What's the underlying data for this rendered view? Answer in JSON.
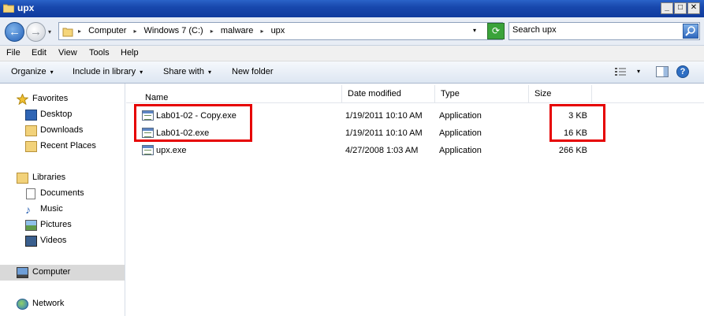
{
  "window": {
    "title": "upx",
    "minimize_glyph": "_",
    "maximize_glyph": "□",
    "close_glyph": "✕"
  },
  "address_bar": {
    "breadcrumbs": [
      "Computer",
      "Windows 7 (C:)",
      "malware",
      "upx"
    ],
    "separator": "▸",
    "dropdown_glyph": "▾"
  },
  "search": {
    "value": "Search upx"
  },
  "menu": {
    "items": [
      "File",
      "Edit",
      "View",
      "Tools",
      "Help"
    ]
  },
  "toolbar": {
    "organize": "Organize",
    "include_in_library": "Include in library",
    "share_with": "Share with",
    "new_folder": "New folder",
    "dropdown_glyph": "▾"
  },
  "nav_pane": {
    "favorites": {
      "label": "Favorites",
      "items": [
        "Desktop",
        "Downloads",
        "Recent Places"
      ]
    },
    "libraries": {
      "label": "Libraries",
      "items": [
        "Documents",
        "Music",
        "Pictures",
        "Videos"
      ]
    },
    "computer": "Computer",
    "network": "Network"
  },
  "file_list": {
    "columns": {
      "name": "Name",
      "date_modified": "Date modified",
      "type": "Type",
      "size": "Size"
    },
    "sort_glyph": "▴",
    "rows": [
      {
        "name": "Lab01-02 - Copy.exe",
        "date_modified": "1/19/2011 10:10 AM",
        "type": "Application",
        "size": "3 KB"
      },
      {
        "name": "Lab01-02.exe",
        "date_modified": "1/19/2011 10:10 AM",
        "type": "Application",
        "size": "16 KB"
      },
      {
        "name": "upx.exe",
        "date_modified": "4/27/2008 1:03 AM",
        "type": "Application",
        "size": "266 KB"
      }
    ]
  },
  "colors": {
    "title_bar": "#1848ad",
    "highlight_box": "#e60000",
    "selected_nav": "#d9d9d9"
  }
}
